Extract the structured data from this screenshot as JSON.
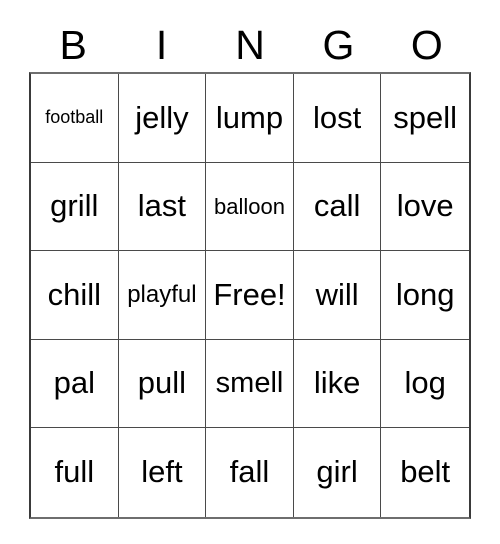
{
  "card": {
    "header_letters": [
      "B",
      "I",
      "N",
      "G",
      "O"
    ],
    "columns": 5,
    "rows": 5,
    "free_space_label": "Free!",
    "cells": [
      {
        "text": "football",
        "size": "xs"
      },
      {
        "text": "jelly",
        "size": "xl"
      },
      {
        "text": "lump",
        "size": "xl"
      },
      {
        "text": "lost",
        "size": "xl"
      },
      {
        "text": "spell",
        "size": "xl"
      },
      {
        "text": "grill",
        "size": "xl"
      },
      {
        "text": "last",
        "size": "xl"
      },
      {
        "text": "balloon",
        "size": "sm"
      },
      {
        "text": "call",
        "size": "xl"
      },
      {
        "text": "love",
        "size": "xl"
      },
      {
        "text": "chill",
        "size": "xl"
      },
      {
        "text": "playful",
        "size": "md"
      },
      {
        "text": "Free!",
        "size": "xl"
      },
      {
        "text": "will",
        "size": "xl"
      },
      {
        "text": "long",
        "size": "xl"
      },
      {
        "text": "pal",
        "size": "xl"
      },
      {
        "text": "pull",
        "size": "xl"
      },
      {
        "text": "smell",
        "size": "lg"
      },
      {
        "text": "like",
        "size": "xl"
      },
      {
        "text": "log",
        "size": "xl"
      },
      {
        "text": "full",
        "size": "xl"
      },
      {
        "text": "left",
        "size": "xl"
      },
      {
        "text": "fall",
        "size": "xl"
      },
      {
        "text": "girl",
        "size": "xl"
      },
      {
        "text": "belt",
        "size": "xl"
      }
    ]
  },
  "colors": {
    "background": "#ffffff",
    "text": "#000000",
    "grid_line": "#4a4a4a",
    "grid_outer": "#3a3a3a"
  }
}
